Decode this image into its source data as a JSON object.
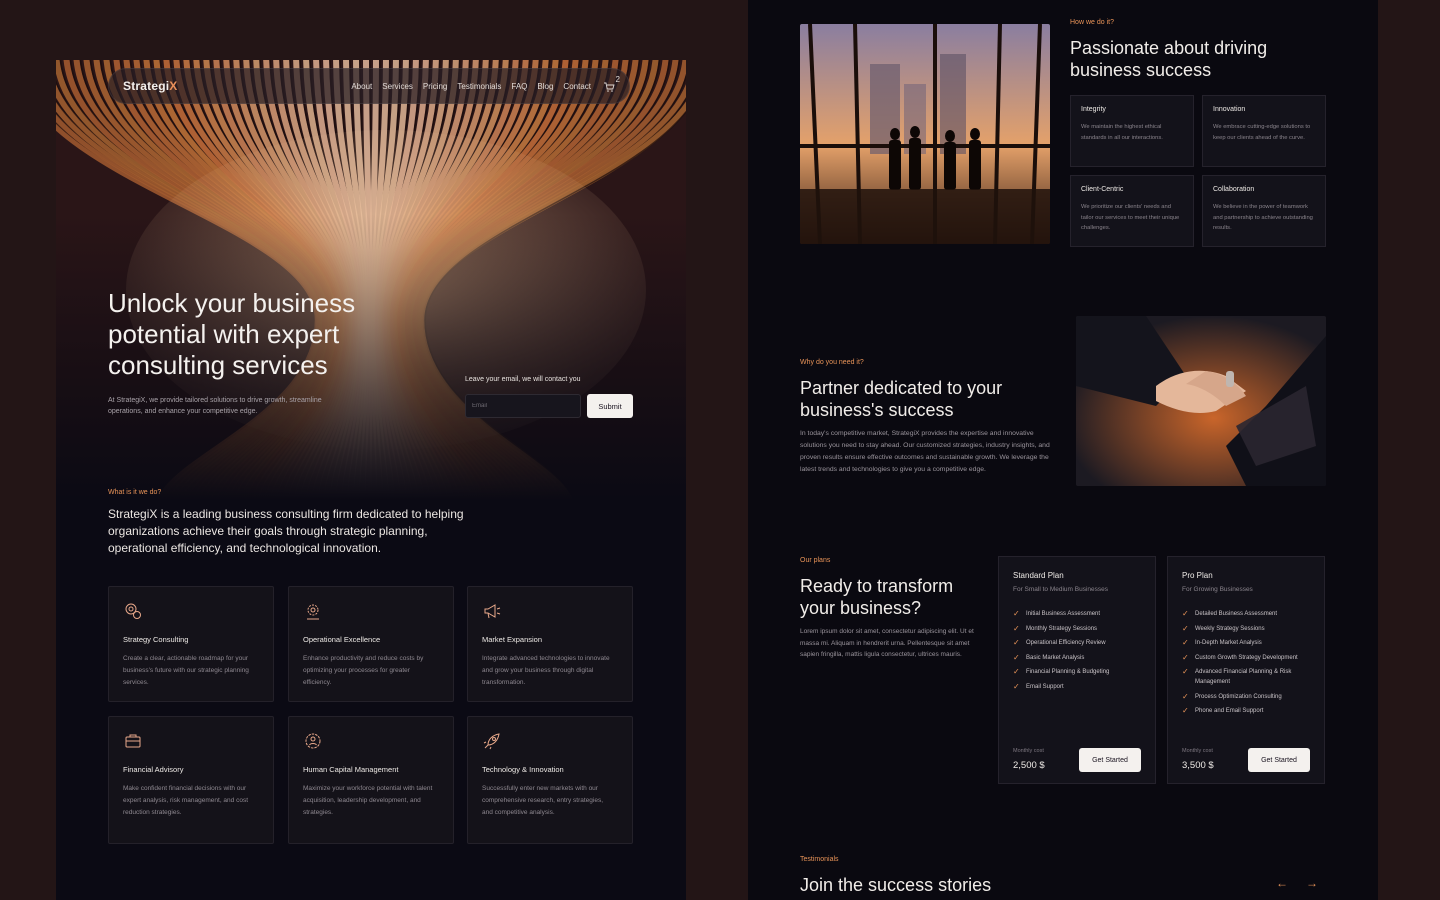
{
  "brand": {
    "name_main": "Strategi",
    "name_accent": "X",
    "accent_color": "#e9905a"
  },
  "nav": {
    "links": [
      "About",
      "Services",
      "Pricing",
      "Testimonials",
      "FAQ",
      "Blog",
      "Contact"
    ],
    "cart_icon": "cart-icon",
    "cart_count": "2"
  },
  "hero": {
    "title": "Unlock your business potential with expert consulting services",
    "description": "At StrategiX, we provide tailored solutions to drive growth, streamline operations, and enhance your competitive edge.",
    "lead_label": "Leave your email, we will contact you",
    "email_placeholder": "Email",
    "submit_label": "Submit"
  },
  "what": {
    "eyebrow": "What is it we do?",
    "text": "StrategiX is a leading business consulting firm dedicated to helping organizations achieve their goals through strategic planning, operational efficiency, and technological innovation."
  },
  "services": [
    {
      "icon": "gears-icon",
      "title": "Strategy Consulting",
      "desc": "Create a clear, actionable roadmap for your business's future with our strategic planning services."
    },
    {
      "icon": "cog-people-icon",
      "title": "Operational Excellence",
      "desc": "Enhance productivity and reduce costs by optimizing your processes for greater efficiency."
    },
    {
      "icon": "megaphone-icon",
      "title": "Market Expansion",
      "desc": "Integrate advanced technologies to innovate and grow your business through digital transformation."
    },
    {
      "icon": "briefcase-icon",
      "title": "Financial Advisory",
      "desc": "Make confident financial decisions with our expert analysis, risk management, and cost reduction strategies."
    },
    {
      "icon": "person-gear-icon",
      "title": "Human Capital Management",
      "desc": "Maximize your workforce potential with talent acquisition, leadership development, and strategies."
    },
    {
      "icon": "rocket-icon",
      "title": "Technology & Innovation",
      "desc": "Successfully enter new markets with our comprehensive research, entry strategies, and competitive analysis."
    }
  ],
  "how": {
    "eyebrow": "How we do it?",
    "title": "Passionate about driving business success",
    "values": [
      {
        "title": "Integrity",
        "desc": "We maintain the highest ethical standards in all our interactions."
      },
      {
        "title": "Innovation",
        "desc": "We embrace cutting-edge solutions to keep our clients ahead of the curve."
      },
      {
        "title": "Client-Centric",
        "desc": "We prioritize our clients' needs and tailor our services to meet their unique challenges."
      },
      {
        "title": "Collaboration",
        "desc": "We believe in the power of teamwork and partnership to achieve outstanding results."
      }
    ]
  },
  "why": {
    "eyebrow": "Why do you need it?",
    "title": "Partner dedicated to your business's success",
    "body": "In today's competitive market, StrategiX provides the expertise and innovative solutions you need to stay ahead. Our customized strategies, industry insights, and proven results ensure effective outcomes and sustainable growth. We leverage the latest trends and technologies to give you a competitive edge."
  },
  "plans": {
    "eyebrow": "Our plans",
    "title": "Ready to transform your business?",
    "body": "Lorem ipsum dolor sit amet, consectetur adipiscing elit. Ut et massa mi. Aliquam in hendrerit urna. Pellentesque sit amet sapien fringilla, mattis ligula consectetur, ultrices mauris.",
    "items": [
      {
        "name": "Standard Plan",
        "sub": "For Small to Medium Businesses",
        "features": [
          "Initial Business Assessment",
          "Monthly Strategy Sessions",
          "Operational Efficiency Review",
          "Basic Market Analysis",
          "Financial Planning & Budgeting",
          "Email Support"
        ],
        "cost_label": "Monthly cost",
        "price": "2,500 $",
        "cta": "Get Started"
      },
      {
        "name": "Pro Plan",
        "sub": "For Growing Businesses",
        "features": [
          "Detailed Business Assessment",
          "Weekly Strategy Sessions",
          "In-Depth Market Analysis",
          "Custom Growth Strategy Development",
          "Advanced Financial Planning & Risk Management",
          "Process Optimization Consulting",
          "Phone and Email Support"
        ],
        "cost_label": "Monthly cost",
        "price": "3,500 $",
        "cta": "Get Started"
      }
    ]
  },
  "testimonials": {
    "eyebrow": "Testimonials",
    "title": "Join the success stories",
    "prev_icon": "arrow-left-icon",
    "next_icon": "arrow-right-icon",
    "prev_glyph": "←",
    "next_glyph": "→"
  }
}
